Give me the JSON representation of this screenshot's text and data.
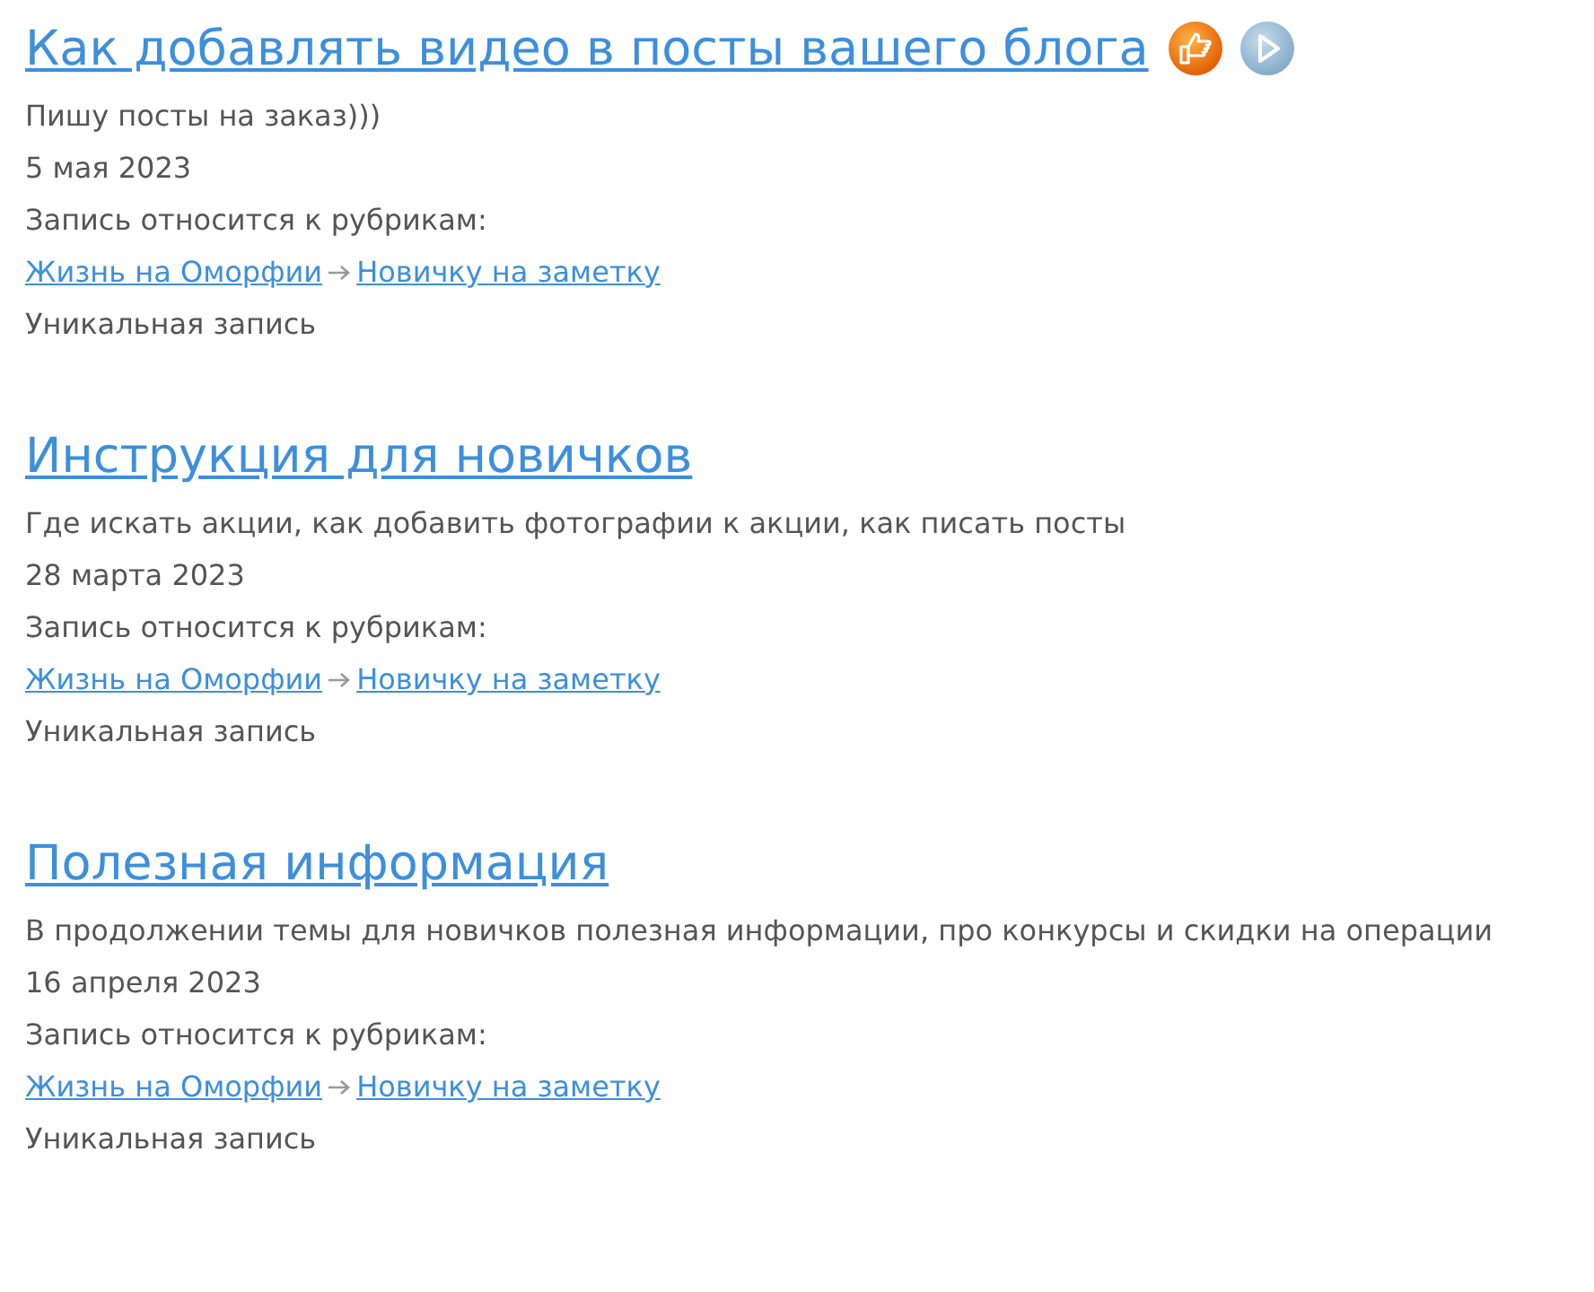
{
  "posts": [
    {
      "title": "Как добавлять видео в посты вашего блога",
      "badges": [
        {
          "kind": "like"
        },
        {
          "kind": "play"
        }
      ],
      "description": "Пишу посты на заказ)))",
      "date": "5 мая 2023",
      "categories_label": "Запись относится к рубрикам:",
      "categories": [
        "Жизнь на Оморфии",
        "Новичку на заметку"
      ],
      "note": "Уникальная запись"
    },
    {
      "title": "Инструкция для новичков",
      "description": "Где искать акции, как добавить фотографии к акции, как писать посты",
      "date": "28 марта 2023",
      "categories_label": "Запись относится к рубрикам:",
      "categories": [
        "Жизнь на Оморфии",
        "Новичку на заметку"
      ],
      "note": "Уникальная запись"
    },
    {
      "title": "Полезная информация",
      "description": "В продолжении темы для новичков полезная информации, про конкурсы и скидки на операции",
      "date": "16 апреля 2023",
      "categories_label": "Запись относится к рубрикам:",
      "categories": [
        "Жизнь на Оморфии",
        "Новичку на заметку"
      ],
      "note": "Уникальная запись"
    }
  ]
}
